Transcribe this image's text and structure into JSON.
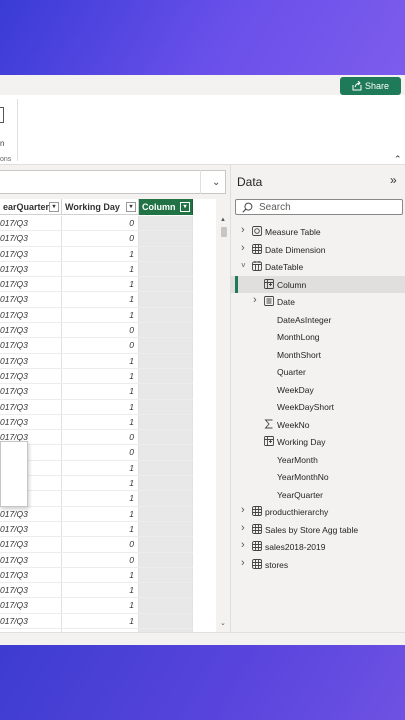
{
  "header": {
    "share_label": "Share",
    "ribbon_text_1": "n",
    "ribbon_text_2": "ons"
  },
  "table": {
    "columns": [
      {
        "label": "earQuarter",
        "active": false
      },
      {
        "label": "Working Day",
        "active": false
      },
      {
        "label": "Column",
        "active": true
      }
    ],
    "rows": [
      {
        "quarter": "017/Q3",
        "working_day": "0"
      },
      {
        "quarter": "017/Q3",
        "working_day": "0"
      },
      {
        "quarter": "017/Q3",
        "working_day": "1"
      },
      {
        "quarter": "017/Q3",
        "working_day": "1"
      },
      {
        "quarter": "017/Q3",
        "working_day": "1"
      },
      {
        "quarter": "017/Q3",
        "working_day": "1"
      },
      {
        "quarter": "017/Q3",
        "working_day": "1"
      },
      {
        "quarter": "017/Q3",
        "working_day": "0"
      },
      {
        "quarter": "017/Q3",
        "working_day": "0"
      },
      {
        "quarter": "017/Q3",
        "working_day": "1"
      },
      {
        "quarter": "017/Q3",
        "working_day": "1"
      },
      {
        "quarter": "017/Q3",
        "working_day": "1"
      },
      {
        "quarter": "017/Q3",
        "working_day": "1"
      },
      {
        "quarter": "017/Q3",
        "working_day": "1"
      },
      {
        "quarter": "017/Q3",
        "working_day": "0"
      },
      {
        "quarter": "017/Q3",
        "working_day": "0"
      },
      {
        "quarter": "017/Q3",
        "working_day": "1"
      },
      {
        "quarter": "017/Q3",
        "working_day": "1"
      },
      {
        "quarter": "017/Q3",
        "working_day": "1"
      },
      {
        "quarter": "017/Q3",
        "working_day": "1"
      },
      {
        "quarter": "017/Q3",
        "working_day": "1"
      },
      {
        "quarter": "017/Q3",
        "working_day": "0"
      },
      {
        "quarter": "017/Q3",
        "working_day": "0"
      },
      {
        "quarter": "017/Q3",
        "working_day": "1"
      },
      {
        "quarter": "017/Q3",
        "working_day": "1"
      },
      {
        "quarter": "017/Q3",
        "working_day": "1"
      },
      {
        "quarter": "017/Q3",
        "working_day": "1"
      },
      {
        "quarter": "017/Q3",
        "working_day": ""
      }
    ]
  },
  "data_pane": {
    "title": "Data",
    "search_placeholder": "Search",
    "tree": [
      {
        "label": "Measure Table",
        "icon": "measure-table-icon",
        "chevron": "right",
        "level": 0
      },
      {
        "label": "Date Dimension",
        "icon": "table-icon",
        "chevron": "right",
        "level": 0
      },
      {
        "label": "DateTable",
        "icon": "calendar-table-icon",
        "chevron": "down",
        "level": 0
      },
      {
        "label": "Column",
        "icon": "calculated-column-icon",
        "chevron": "",
        "level": 1,
        "selected": true
      },
      {
        "label": "Date",
        "icon": "hierarchy-icon",
        "chevron": "right",
        "level": 1
      },
      {
        "label": "DateAsInteger",
        "icon": "",
        "chevron": "",
        "level": 1
      },
      {
        "label": "MonthLong",
        "icon": "",
        "chevron": "",
        "level": 1
      },
      {
        "label": "MonthShort",
        "icon": "",
        "chevron": "",
        "level": 1
      },
      {
        "label": "Quarter",
        "icon": "",
        "chevron": "",
        "level": 1
      },
      {
        "label": "WeekDay",
        "icon": "",
        "chevron": "",
        "level": 1
      },
      {
        "label": "WeekDayShort",
        "icon": "",
        "chevron": "",
        "level": 1
      },
      {
        "label": "WeekNo",
        "icon": "sigma-icon",
        "chevron": "",
        "level": 1
      },
      {
        "label": "Working Day",
        "icon": "calculated-column-icon",
        "chevron": "",
        "level": 1
      },
      {
        "label": "YearMonth",
        "icon": "",
        "chevron": "",
        "level": 1
      },
      {
        "label": "YearMonthNo",
        "icon": "",
        "chevron": "",
        "level": 1
      },
      {
        "label": "YearQuarter",
        "icon": "",
        "chevron": "",
        "level": 1
      },
      {
        "label": "producthierarchy",
        "icon": "table-icon",
        "chevron": "right",
        "level": 0
      },
      {
        "label": "Sales by Store Agg table",
        "icon": "table-icon",
        "chevron": "right",
        "level": 0
      },
      {
        "label": "sales2018-2019",
        "icon": "table-icon",
        "chevron": "right",
        "level": 0
      },
      {
        "label": "stores",
        "icon": "table-icon",
        "chevron": "right",
        "level": 0
      }
    ]
  },
  "colors": {
    "accent_green": "#217346",
    "share_green": "#1f7a5a",
    "purple_bg": "#5d47e8"
  }
}
